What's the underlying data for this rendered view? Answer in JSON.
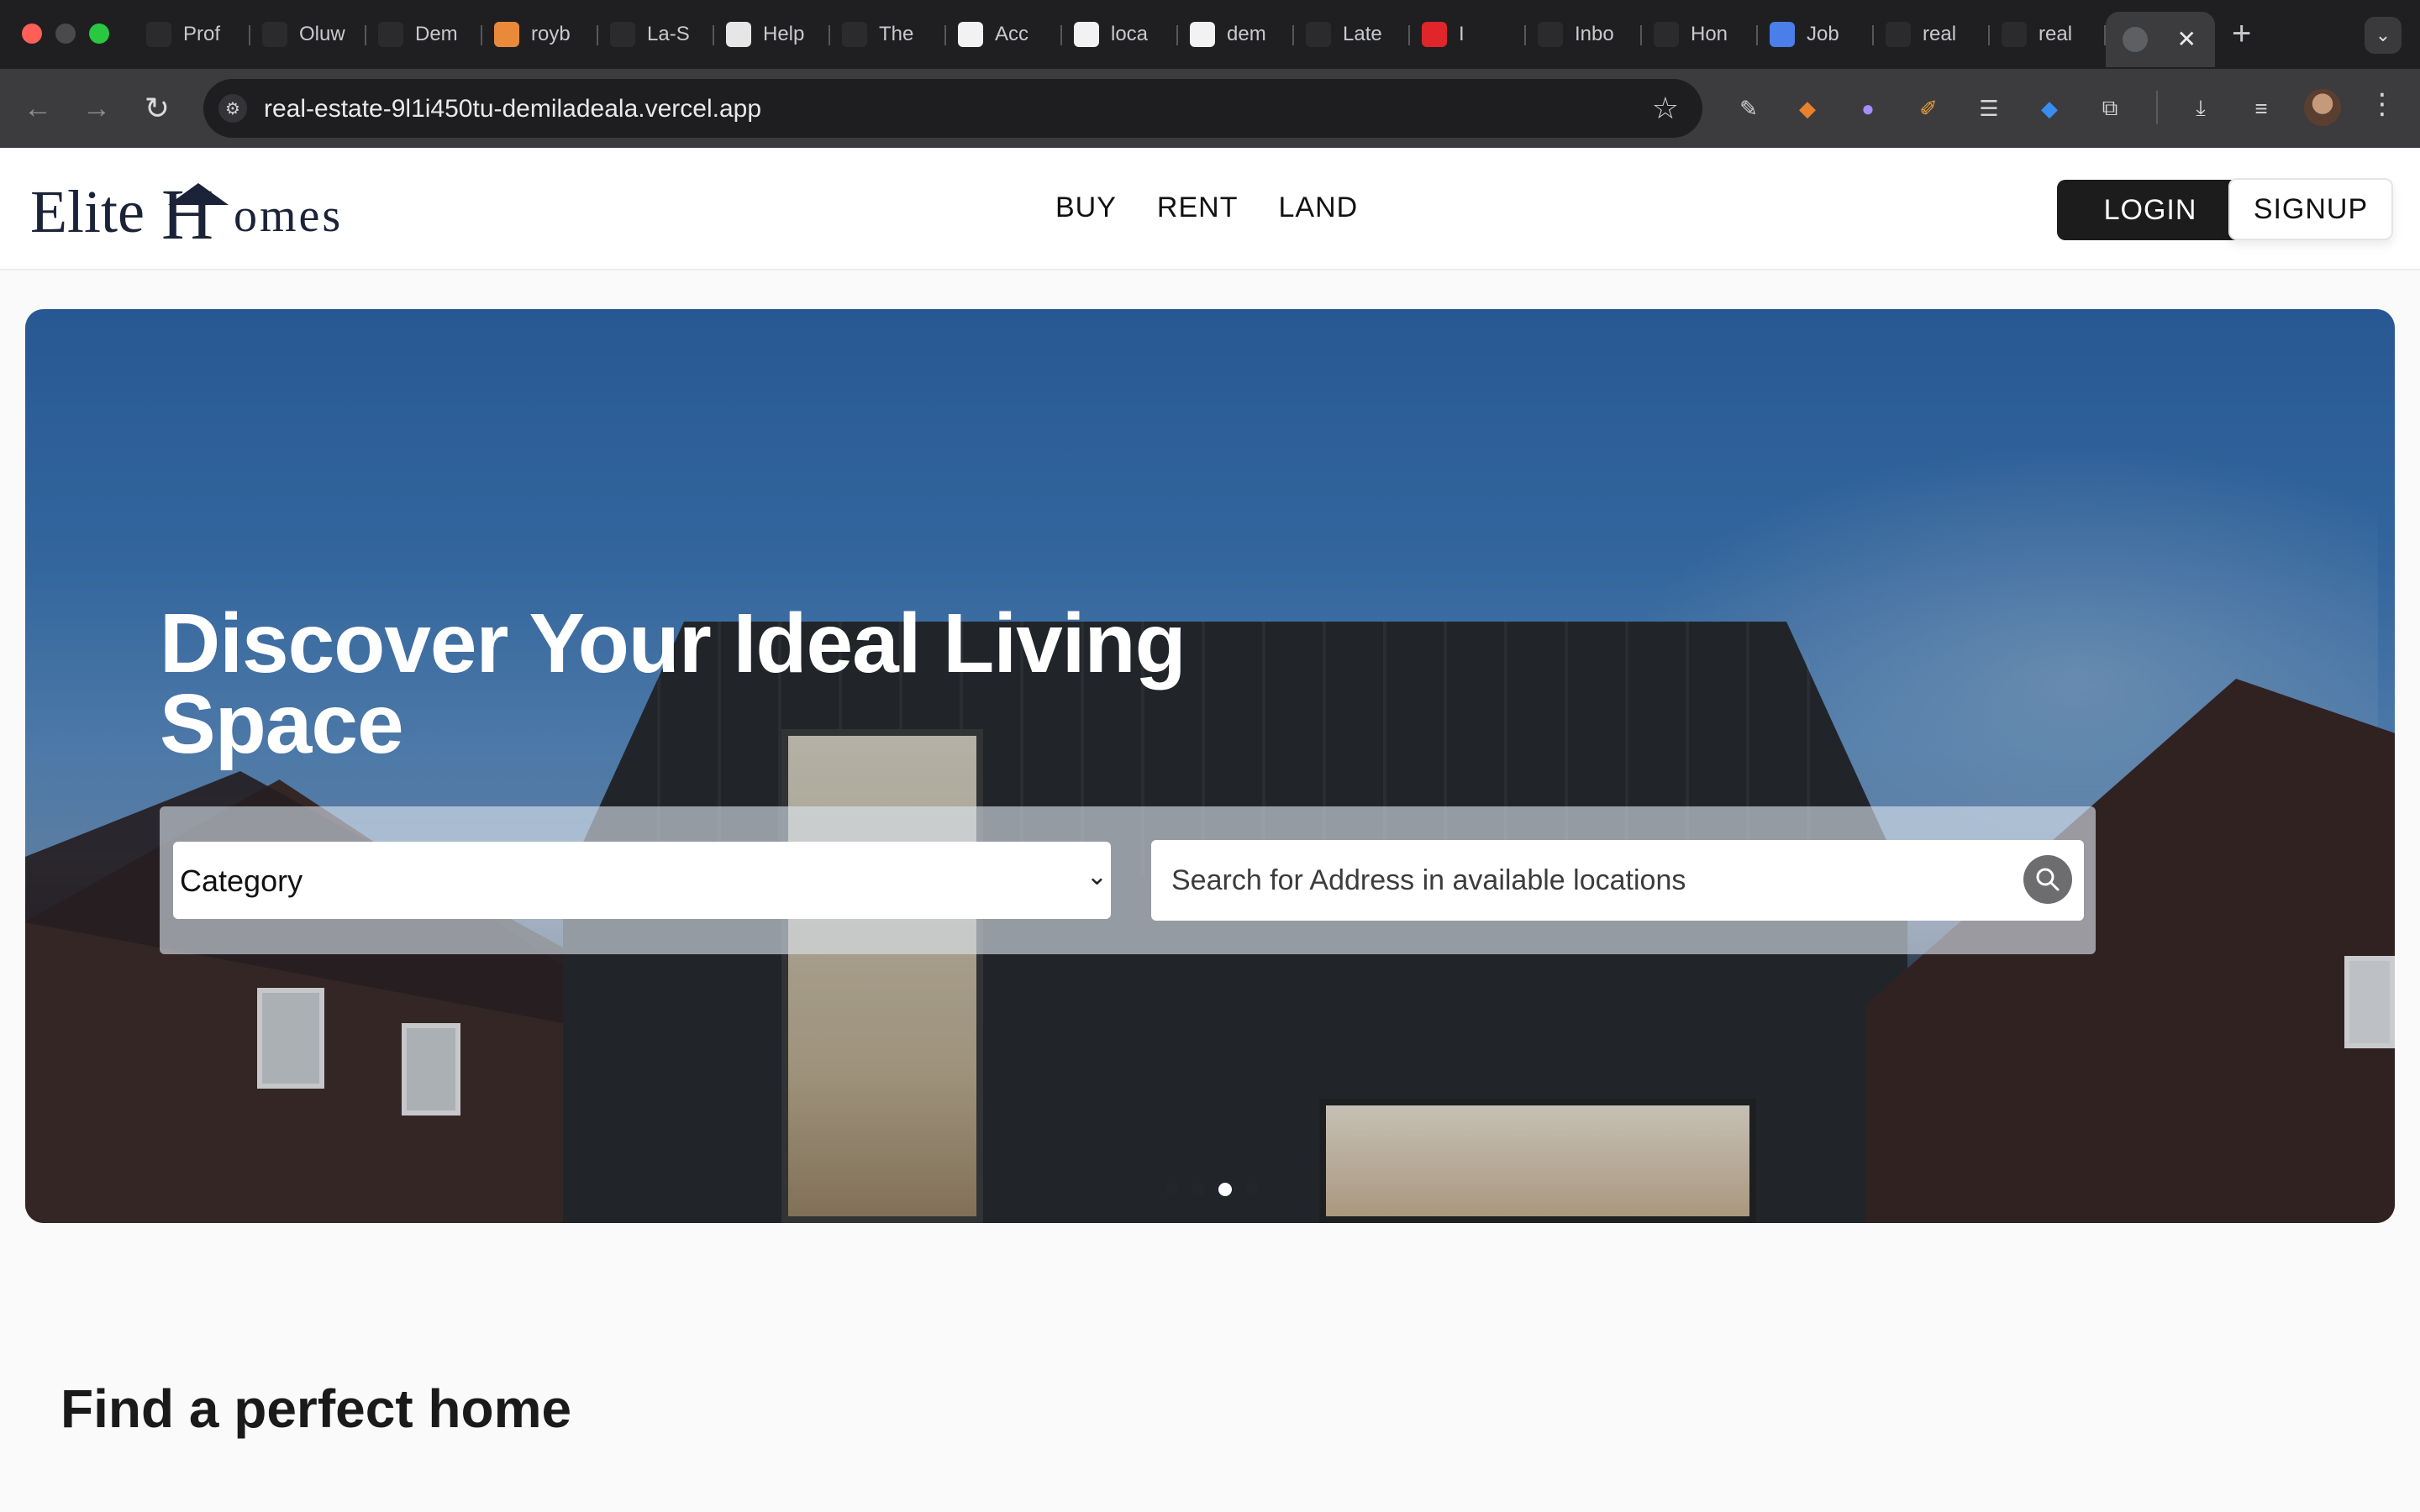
{
  "browser": {
    "tabs": [
      {
        "title": "Prof",
        "icon": "openai-icon",
        "color": "#2b2b2e"
      },
      {
        "title": "Oluw",
        "icon": "ol-icon",
        "color": "#2b2b2e"
      },
      {
        "title": "Dem",
        "icon": "github-icon",
        "color": "#2b2b2e"
      },
      {
        "title": "royb",
        "icon": "roy-icon",
        "color": "#e88a3a"
      },
      {
        "title": "La-S",
        "icon": "dot-icon",
        "color": "#2b2b2e"
      },
      {
        "title": "Help",
        "icon": "help-icon",
        "color": "#e6e6e6"
      },
      {
        "title": "The",
        "icon": "book-icon",
        "color": "#2b2b2e"
      },
      {
        "title": "Acc",
        "icon": "vercel-account-icon",
        "color": "#f2f2f2"
      },
      {
        "title": "loca",
        "icon": "local-icon",
        "color": "#f2f2f2"
      },
      {
        "title": "dem",
        "icon": "doc-icon",
        "color": "#f2f2f2"
      },
      {
        "title": "Late",
        "icon": "figma-icon",
        "color": "#2b2b2e"
      },
      {
        "title": "I",
        "icon": "youtube-music-icon",
        "color": "#e0252b"
      },
      {
        "title": "Inbo",
        "icon": "gmail-icon",
        "color": "#2b2b2e"
      },
      {
        "title": "Hon",
        "icon": "x-icon",
        "color": "#2b2b2e"
      },
      {
        "title": "Job",
        "icon": "google-docs-icon",
        "color": "#4a7ee8"
      },
      {
        "title": "real",
        "icon": "bolt-icon",
        "color": "#2b2b2e"
      },
      {
        "title": "real",
        "icon": "vercel-icon",
        "color": "#2b2b2e"
      }
    ],
    "url": "real-estate-9l1i450tu-demiladeala.vercel.app",
    "new_tab_label": "+",
    "close_label": "✕"
  },
  "header": {
    "logo_part1": "Elite",
    "logo_letter": "H",
    "logo_part2": "omes",
    "nav": [
      "BUY",
      "RENT",
      "LAND"
    ],
    "login_label": "LOGIN",
    "signup_label": "SIGNUP"
  },
  "hero": {
    "title": "Discover Your Ideal Living Space",
    "category_label": "Category",
    "search_placeholder": "Search for Address in available locations",
    "carousel_dots": 4,
    "carousel_active": 2
  },
  "section": {
    "find_prefix": "Find a",
    "find_bold": "perfect home"
  }
}
